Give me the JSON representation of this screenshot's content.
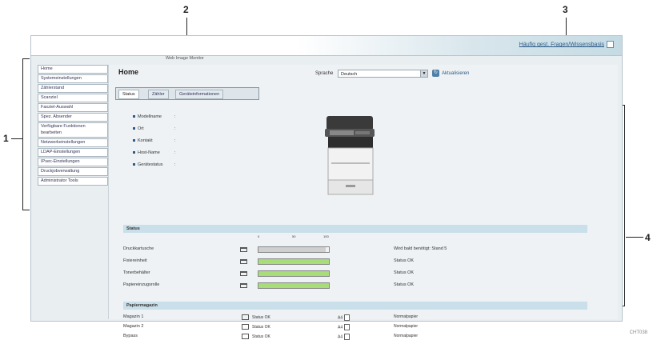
{
  "callouts": [
    "1",
    "2",
    "3",
    "4"
  ],
  "header": {
    "help_link": "Häufig gest. Fragen/Wissensbasis",
    "monitor_label": "Web Image Monitor"
  },
  "sidebar": {
    "items": [
      {
        "label": "Home"
      },
      {
        "label": "Systemeinstellungen"
      },
      {
        "label": "Zählerstand"
      },
      {
        "label": "Scanziel"
      },
      {
        "label": "Faxziel-Auswahl"
      },
      {
        "label": "Spez. Absender"
      },
      {
        "label": "Verfügbare Funktionen bearbeiten"
      },
      {
        "label": "Netzwerkeinstellungen"
      },
      {
        "label": "LDAP-Einstellungen"
      },
      {
        "label": "IPsec-Einstellungen"
      },
      {
        "label": "Druckjobverwaltung"
      },
      {
        "label": "Administrator Tools"
      }
    ]
  },
  "main": {
    "title": "Home",
    "language_label": "Sprache",
    "language_value": "Deutsch",
    "refresh_label": "Aktualisieren",
    "tabs": [
      "Status",
      "Zähler",
      "Geräteinformationen"
    ],
    "info_rows": [
      "Modellname",
      "Ort",
      "Kontakt",
      "Host-Name",
      "Gerätestatus"
    ],
    "info_separator": ":",
    "status_section": "Status",
    "scale_marks": [
      "0",
      "50",
      "100"
    ],
    "status_rows": [
      {
        "label": "Druckkartusche",
        "status": "Wird bald benötigt: Stand 5",
        "level": 0.95,
        "color": "#cfcfcf"
      },
      {
        "label": "Fixiereinheit",
        "status": "Status OK",
        "level": 1.0,
        "color": "#a8dd7a"
      },
      {
        "label": "Tonerbehälter",
        "status": "Status OK",
        "level": 1.0,
        "color": "#a8dd7a"
      },
      {
        "label": "Papiereinzugsrolle",
        "status": "Status OK",
        "level": 1.0,
        "color": "#a8dd7a"
      }
    ],
    "paper_section": "Papiermagazin",
    "paper_rows": [
      {
        "label": "Magazin 1",
        "status": "Status OK",
        "size": "A4",
        "type": "Normalpapier"
      },
      {
        "label": "Magazin 2",
        "status": "Status OK",
        "size": "A4",
        "type": "Normalpapier"
      },
      {
        "label": "Bypass",
        "status": "Status OK",
        "size": "A4",
        "type": "Normalpapier"
      }
    ]
  },
  "footer_code": "CHT038"
}
